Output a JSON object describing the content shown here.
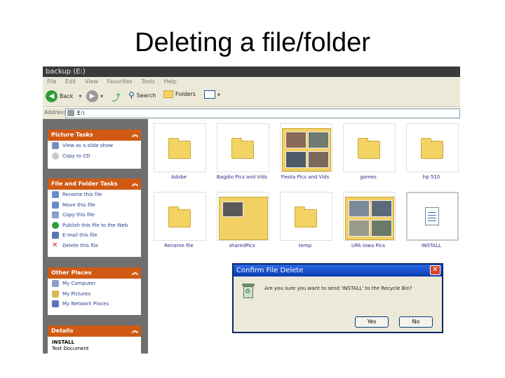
{
  "slide": {
    "title": "Deleting a file/folder"
  },
  "window": {
    "title": "backup (E:)"
  },
  "menu": [
    "File",
    "Edit",
    "View",
    "Favorites",
    "Tools",
    "Help"
  ],
  "toolbar": {
    "back": "Back",
    "search": "Search",
    "folders": "Folders"
  },
  "address": {
    "label": "Address",
    "value": "E:\\"
  },
  "picture_tasks": {
    "header": "Picture Tasks",
    "items": [
      "View as a slide show",
      "Copy to CD"
    ]
  },
  "file_tasks": {
    "header": "File and Folder Tasks",
    "items": [
      "Rename this file",
      "Move this file",
      "Copy this file",
      "Publish this file to the Web",
      "E-mail this file",
      "Delete this file"
    ]
  },
  "other_places": {
    "header": "Other Places",
    "items": [
      "My Computer",
      "My Pictures",
      "My Network Places"
    ]
  },
  "details": {
    "header": "Details",
    "name": "INSTALL",
    "type": "Text Document"
  },
  "files": [
    {
      "name": "Adobe"
    },
    {
      "name": "Bagdio Pics and Vids"
    },
    {
      "name": "Fiesta Pics and Vids"
    },
    {
      "name": "games"
    },
    {
      "name": "hp 510"
    },
    {
      "name": "Rename file"
    },
    {
      "name": "sharedPics"
    },
    {
      "name": "temp"
    },
    {
      "name": "UPA Iowa Pics"
    },
    {
      "name": "INSTALL"
    }
  ],
  "dialog": {
    "title": "Confirm File Delete",
    "message": "Are you sure you want to send 'INSTALL' to the Recycle Bin?",
    "yes": "Yes",
    "no": "No"
  }
}
